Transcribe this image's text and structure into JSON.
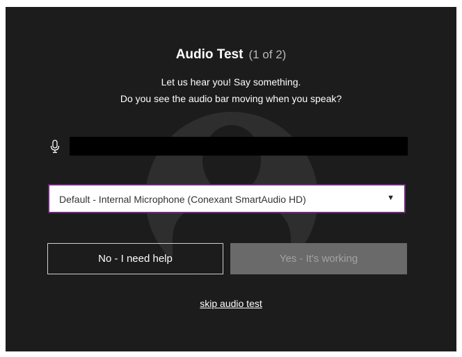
{
  "dialog": {
    "title": "Audio Test",
    "step": "(1 of 2)",
    "instruction_line1": "Let us hear you! Say something.",
    "instruction_line2": "Do you see the audio bar moving when you speak?",
    "background_icon": "user-silhouette-icon"
  },
  "audio_meter": {
    "icon": "microphone-icon",
    "level": 0
  },
  "microphone_select": {
    "selected": "Default - Internal Microphone (Conexant SmartAudio HD)",
    "caret_icon": "caret-down-icon",
    "border_color": "#6f2a7d"
  },
  "buttons": {
    "no_label": "No - I need help",
    "yes_label": "Yes - It's working"
  },
  "skip_link": "skip audio test",
  "colors": {
    "dialog_bg": "#1c1c1c",
    "yes_button_bg": "#6a6a6a",
    "meter_bg": "#000000"
  }
}
